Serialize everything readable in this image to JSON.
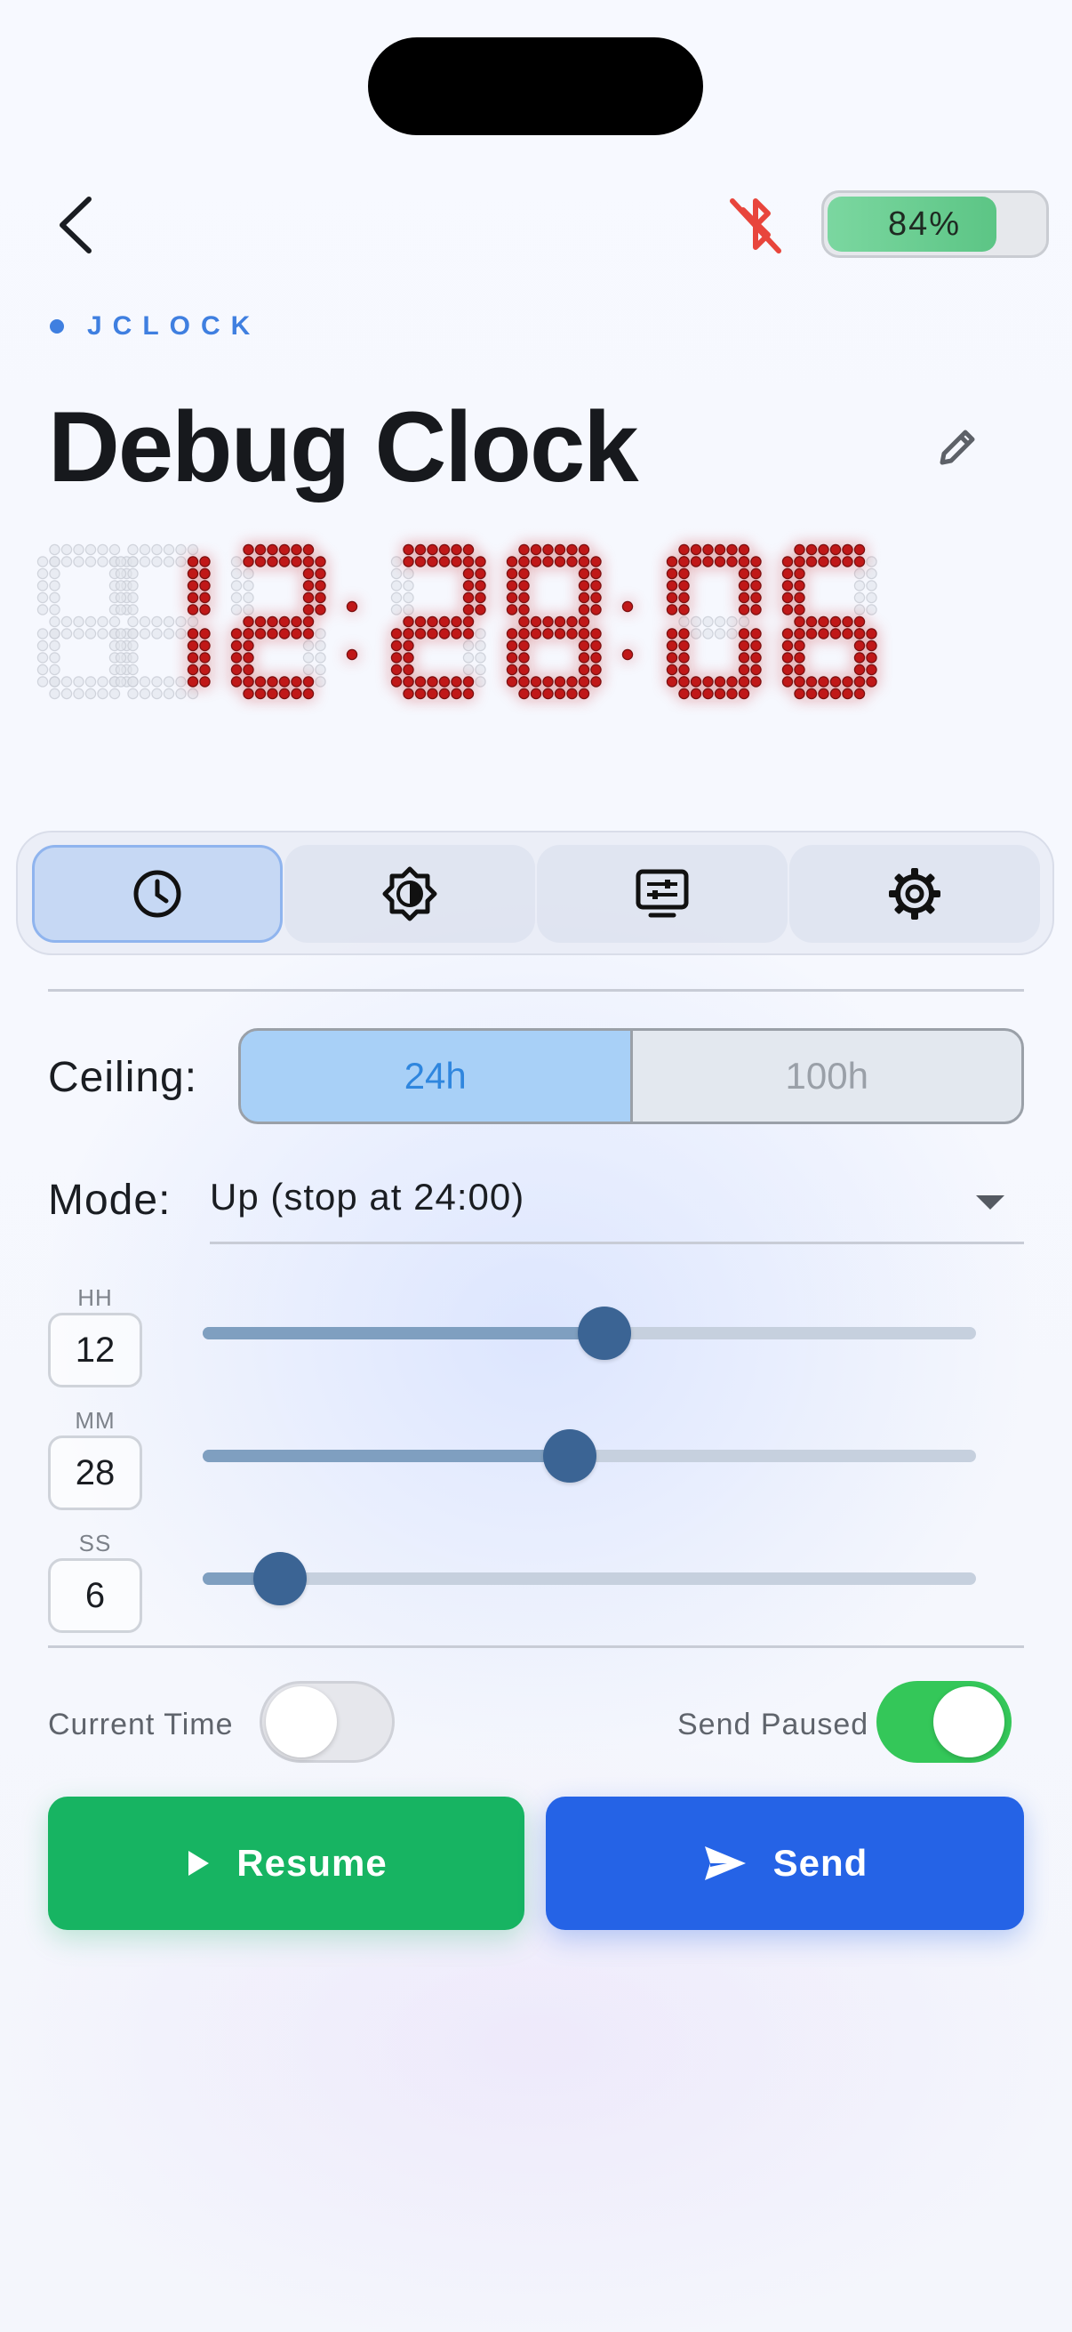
{
  "header": {
    "battery_pct": 84,
    "battery_label": "84%",
    "bluetooth": "disconnected"
  },
  "brand": "JCLOCK",
  "title": "Debug Clock",
  "display": {
    "time": "12:28:06",
    "digit_color": "#c01818"
  },
  "tabs": [
    {
      "name": "tab-clock",
      "icon": "clock-icon",
      "active": true
    },
    {
      "name": "tab-brightness",
      "icon": "brightness-icon",
      "active": false
    },
    {
      "name": "tab-display",
      "icon": "display-settings-icon",
      "active": false
    },
    {
      "name": "tab-settings",
      "icon": "gear-icon",
      "active": false
    }
  ],
  "ceiling": {
    "label": "Ceiling:",
    "options": [
      "24h",
      "100h"
    ],
    "selected": "24h"
  },
  "mode": {
    "label": "Mode:",
    "value": "Up (stop at 24:00)"
  },
  "time_fields": [
    {
      "label": "HH",
      "value": "12",
      "fraction": 0.52
    },
    {
      "label": "MM",
      "value": "28",
      "fraction": 0.475
    },
    {
      "label": "SS",
      "value": "6",
      "fraction": 0.1
    }
  ],
  "toggles": {
    "current_time": {
      "label": "Current Time",
      "on": false
    },
    "send_paused": {
      "label": "Send Paused",
      "on": true
    }
  },
  "buttons": {
    "resume": "Resume",
    "send": "Send"
  },
  "colors": {
    "accent": "#3f7fe0",
    "green": "#17b462",
    "blue": "#2563e6"
  }
}
